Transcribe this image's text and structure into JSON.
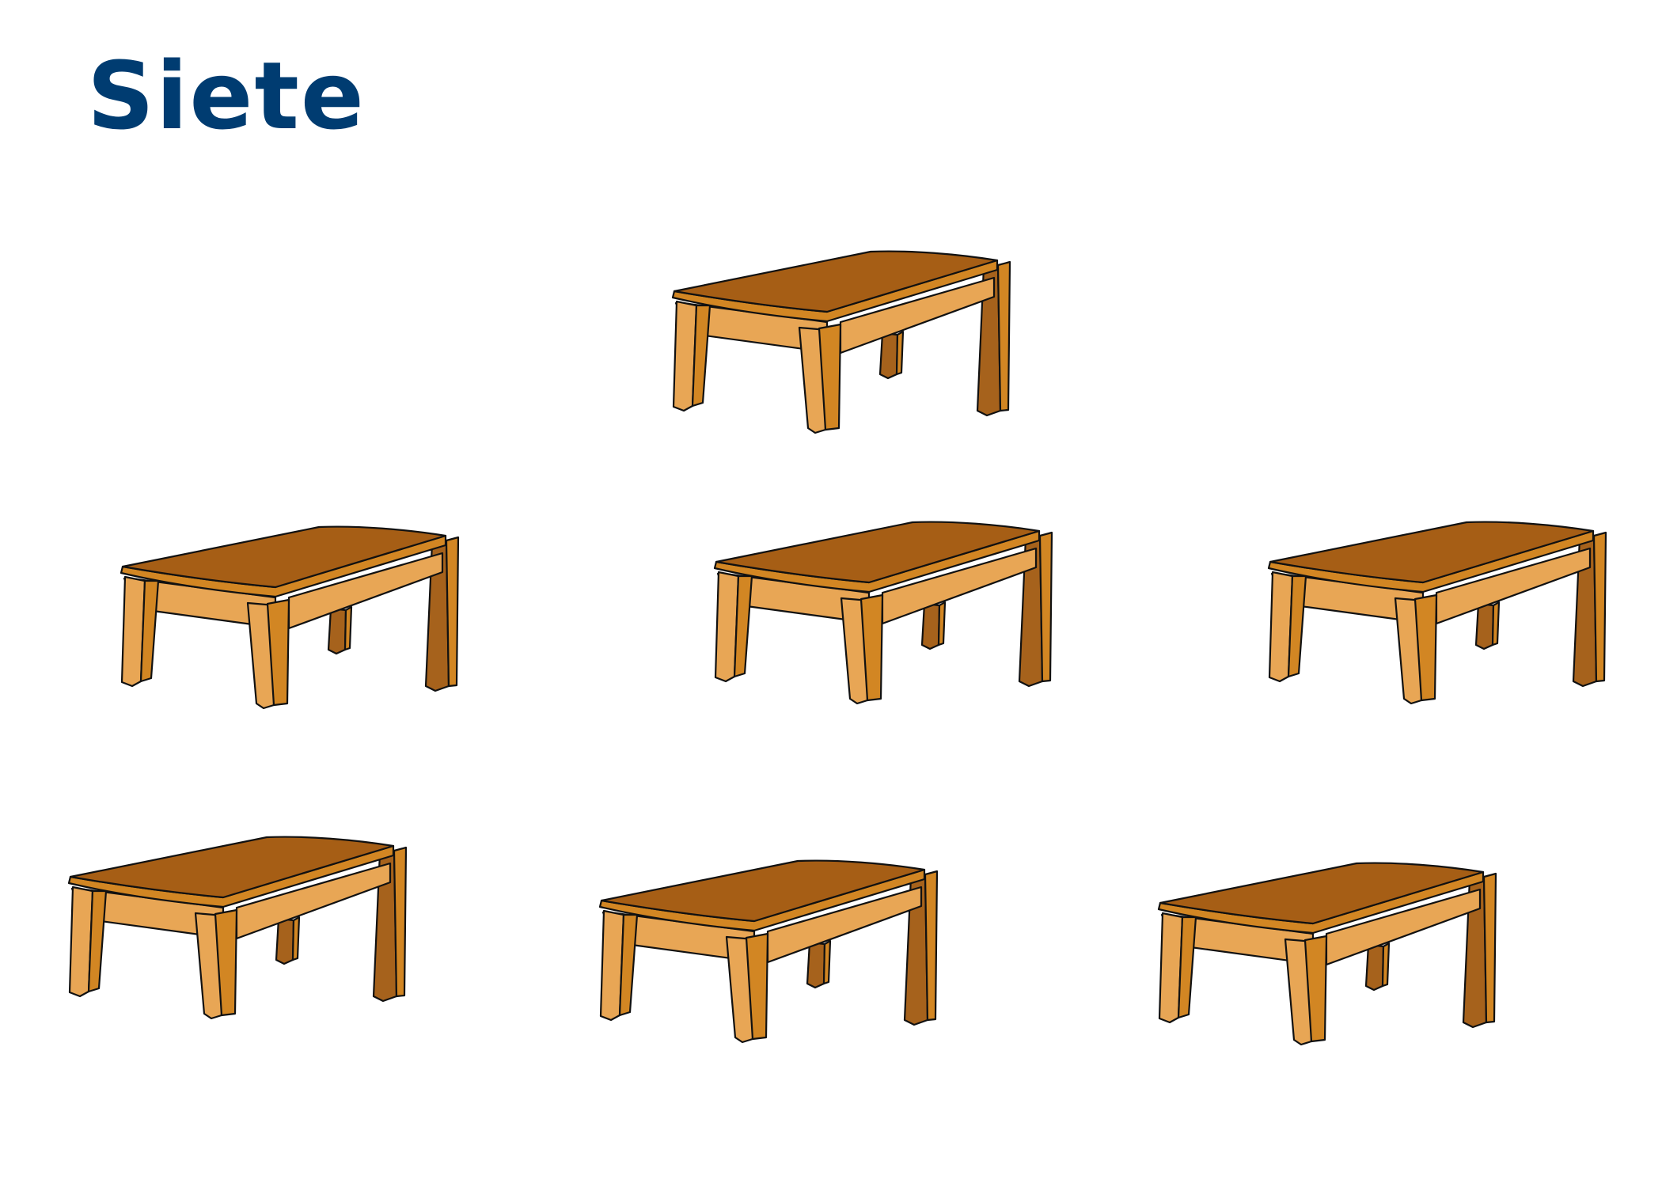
{
  "title": "Siete",
  "colors": {
    "title": "#003c71",
    "tabletop": "#a65e15",
    "wood_light": "#e8a655",
    "wood_mid": "#d28623",
    "wood_dark": "#a6621c",
    "outline": "#111111"
  },
  "illustration": {
    "object": "table-icon",
    "count": 7
  }
}
